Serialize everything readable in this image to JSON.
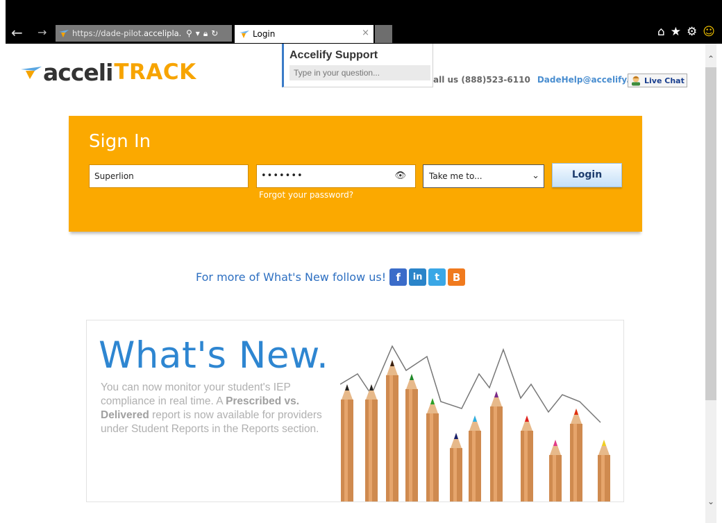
{
  "browser": {
    "url_prefix": "https://dade-pilot.",
    "url_host": "accelipla...",
    "tab_title": "Login",
    "tab_close": "×"
  },
  "logo": {
    "part1": "acceli",
    "part2": "TRACK"
  },
  "support": {
    "title": "Accelify Support",
    "placeholder": "Type in your question..."
  },
  "contact": {
    "call": "all us (888)523-6110",
    "email": "DadeHelp@accelify.com",
    "live_chat": "Live Chat"
  },
  "signin": {
    "title": "Sign In",
    "username": "Superlion",
    "password": "•••••••",
    "forgot": "Forgot your password?",
    "destination": "Take me to...",
    "login": "Login"
  },
  "follow": {
    "text": "For more of What's New follow us!"
  },
  "news": {
    "title": "What's New.",
    "body_1": "You can now monitor your student's IEP compliance in real time. A ",
    "bold_1": "Prescribed vs. Delivered",
    "body_2": " report is now available for providers under Student Reports in the Reports section."
  },
  "colors": {
    "accent_orange": "#fba900",
    "link_blue": "#2d6fc1",
    "title_blue": "#2e86d1"
  }
}
